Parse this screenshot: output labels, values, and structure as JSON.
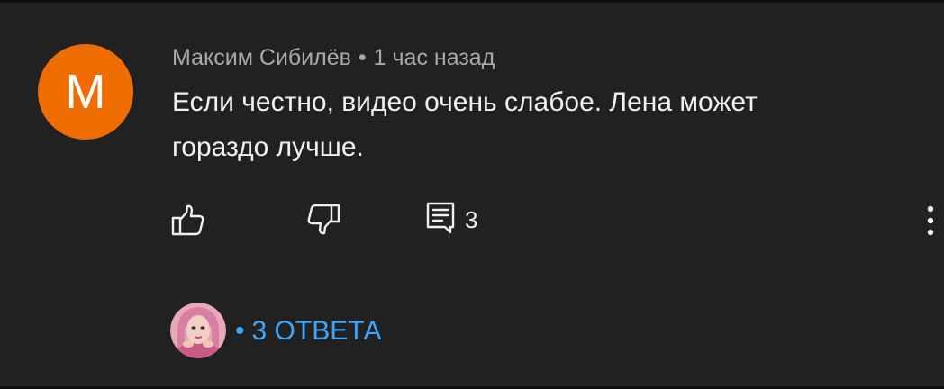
{
  "comment": {
    "avatar_letter": "M",
    "avatar_color": "#ef6c00",
    "author": "Максим Сибилёв",
    "separator": "•",
    "time": "1 час назад",
    "text": "Если честно, видео очень слабое. Лена может гораздо лучше.",
    "reply_count": "3"
  },
  "replies": {
    "separator": "•",
    "label": "3 ОТВЕТА",
    "link_color": "#3ea6ff"
  },
  "icons": {
    "like": "thumb-up-icon",
    "dislike": "thumb-down-icon",
    "reply": "comment-icon",
    "more": "more-vert-icon"
  }
}
